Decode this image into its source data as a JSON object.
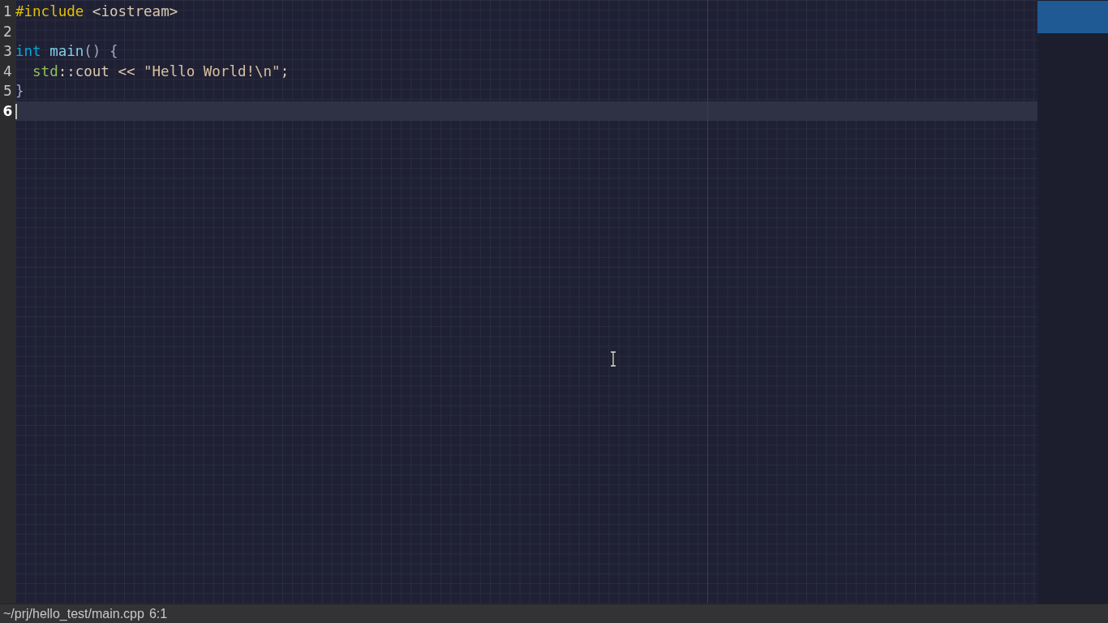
{
  "editor": {
    "lines": [
      {
        "number": "1",
        "current": false,
        "tokens": [
          {
            "kind": "preproc",
            "text": "#include"
          },
          {
            "kind": "plain",
            "text": " <iostream>"
          }
        ]
      },
      {
        "number": "2",
        "current": false
      },
      {
        "number": "3",
        "current": false,
        "tokens": [
          {
            "kind": "type",
            "text": "int"
          },
          {
            "kind": "func",
            "text": " main"
          },
          {
            "kind": "punct",
            "text": "() {"
          }
        ]
      },
      {
        "number": "4",
        "current": false,
        "tokens": [
          {
            "kind": "ns",
            "text": "  std"
          },
          {
            "kind": "plain",
            "text": "::cout << "
          },
          {
            "kind": "string",
            "text": "\"Hello World!\\n\""
          },
          {
            "kind": "plain",
            "text": ";"
          }
        ]
      },
      {
        "number": "5",
        "current": false,
        "tokens": [
          {
            "kind": "punct",
            "text": "}"
          }
        ]
      },
      {
        "number": "6",
        "current": true
      }
    ]
  },
  "status_bar": {
    "path": "~/prj/hello_test/main.cpp",
    "position": "6:1"
  }
}
